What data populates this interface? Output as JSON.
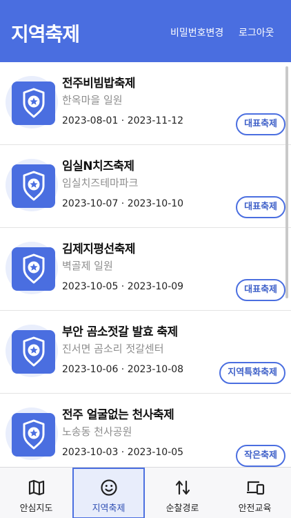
{
  "header": {
    "title": "지역축제",
    "change_password": "비밀번호변경",
    "logout": "로그아웃"
  },
  "festivals": [
    {
      "name": "전주비빔밥축제",
      "place": "한옥마을 일원",
      "dates": "2023-08-01 · 2023-11-12",
      "tag": "대표축제"
    },
    {
      "name": "임실N치즈축제",
      "place": "임실치즈테마파크",
      "dates": "2023-10-07 · 2023-10-10",
      "tag": "대표축제"
    },
    {
      "name": "김제지평선축제",
      "place": "벽골제 일원",
      "dates": "2023-10-05 · 2023-10-09",
      "tag": "대표축제"
    },
    {
      "name": "부안 곰소젓갈 발효 축제",
      "place": "진서면 곰소리 젓갈센터",
      "dates": "2023-10-06 · 2023-10-08",
      "tag": "지역특화축제"
    },
    {
      "name": "전주 얼굴없는 천사축제",
      "place": "노송동 천사공원",
      "dates": "2023-10-03 · 2023-10-05",
      "tag": "작은축제"
    }
  ],
  "tabs": [
    {
      "label": "안심지도",
      "icon": "map-icon"
    },
    {
      "label": "지역축제",
      "icon": "smile-icon",
      "active": true
    },
    {
      "label": "순찰경로",
      "icon": "swap-arrows-icon"
    },
    {
      "label": "안전교육",
      "icon": "devices-icon"
    }
  ],
  "colors": {
    "primary": "#4a6ee0",
    "halo": "#e9eefc",
    "tab_active_bg": "#e8edfb"
  }
}
